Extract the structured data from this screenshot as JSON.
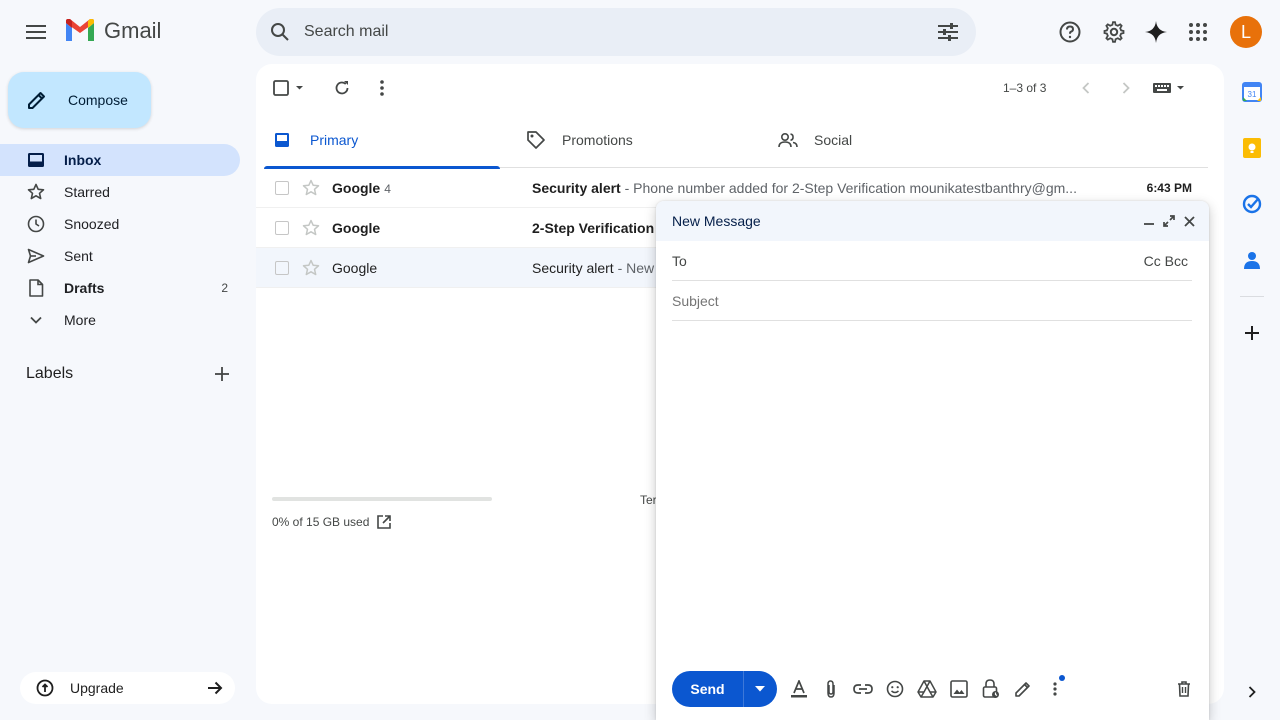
{
  "header": {
    "logo_text": "Gmail",
    "search_placeholder": "Search mail",
    "avatar_letter": "L"
  },
  "sidebar": {
    "compose_label": "Compose",
    "items": [
      {
        "label": "Inbox",
        "count": "",
        "icon": "inbox-icon"
      },
      {
        "label": "Starred",
        "count": "",
        "icon": "star-icon"
      },
      {
        "label": "Snoozed",
        "count": "",
        "icon": "clock-icon"
      },
      {
        "label": "Sent",
        "count": "",
        "icon": "send-icon"
      },
      {
        "label": "Drafts",
        "count": "2",
        "icon": "draft-icon"
      },
      {
        "label": "More",
        "count": "",
        "icon": "chevron-down-icon"
      }
    ],
    "labels_title": "Labels",
    "upgrade_label": "Upgrade"
  },
  "toolbar": {
    "pagination": "1–3 of 3"
  },
  "tabs": [
    {
      "label": "Primary"
    },
    {
      "label": "Promotions"
    },
    {
      "label": "Social"
    }
  ],
  "emails": [
    {
      "sender": "Google",
      "count": "4",
      "subject": "Security alert",
      "snippet": " - Phone number added for 2-Step Verification mounikatestbanthry@gm...",
      "time": "6:43 PM",
      "unread": true
    },
    {
      "sender": "Google",
      "count": "",
      "subject": "2-Step Verification",
      "snippet": "",
      "time": "",
      "unread": true
    },
    {
      "sender": "Google",
      "count": "",
      "subject": "Security alert",
      "snippet": " - New",
      "time": "",
      "unread": false
    }
  ],
  "storage": {
    "label": "0% of 15 GB used",
    "used_fraction": 0.0
  },
  "footer_terms": "Terms",
  "compose_window": {
    "title": "New Message",
    "to_label": "To",
    "cc_bcc": "Cc Bcc",
    "subject_placeholder": "Subject",
    "send_label": "Send"
  },
  "colors": {
    "accent": "#0b57d0",
    "compose_bg": "#c2e7ff",
    "active_nav": "#d3e3fd",
    "avatar": "#e8710a"
  }
}
